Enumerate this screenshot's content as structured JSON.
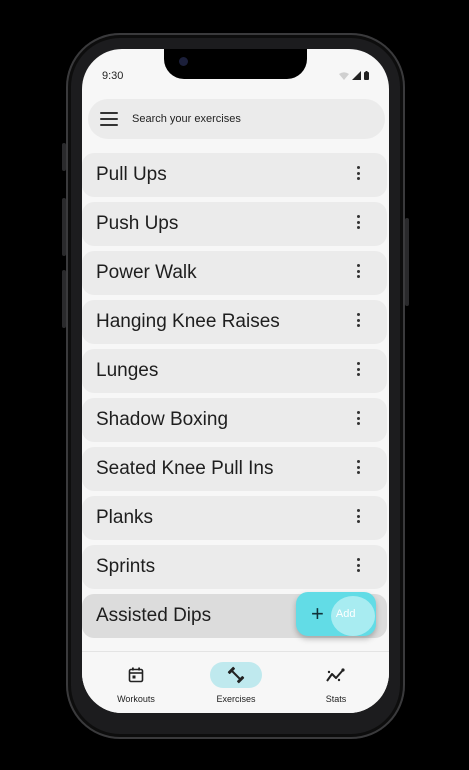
{
  "status": {
    "time": "9:30"
  },
  "search": {
    "placeholder": "Search your exercises"
  },
  "exercises": [
    {
      "label": "Pull Ups"
    },
    {
      "label": "Push Ups"
    },
    {
      "label": "Power Walk"
    },
    {
      "label": "Hanging Knee Raises"
    },
    {
      "label": "Lunges"
    },
    {
      "label": "Shadow Boxing"
    },
    {
      "label": "Seated Knee Pull Ins"
    },
    {
      "label": "Planks"
    },
    {
      "label": "Sprints"
    },
    {
      "label": "Assisted Dips"
    }
  ],
  "fab": {
    "label": "Add",
    "icon": "plus-icon"
  },
  "nav": {
    "items": [
      {
        "label": "Workouts",
        "icon": "calendar-icon"
      },
      {
        "label": "Exercises",
        "icon": "dumbbell-icon",
        "active": true
      },
      {
        "label": "Stats",
        "icon": "trend-icon"
      }
    ]
  },
  "colors": {
    "accent": "#62dce6",
    "active_pill": "#bfe9ee",
    "row_bg": "#ebebeb"
  }
}
